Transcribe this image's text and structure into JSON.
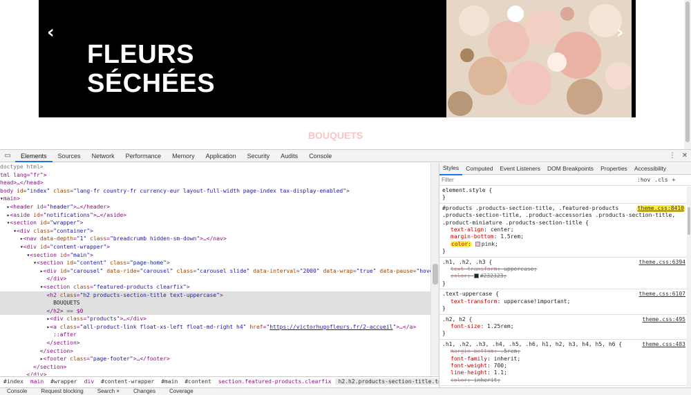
{
  "page": {
    "slide_line1": "FLEURS",
    "slide_line2": "SÉCHÉES",
    "arrow_left": "‹",
    "arrow_right": "›",
    "section_title": "BOUQUETS"
  },
  "devtools": {
    "tabs": [
      "Elements",
      "Sources",
      "Network",
      "Performance",
      "Memory",
      "Application",
      "Security",
      "Audits",
      "Console"
    ],
    "active_tab": "Elements",
    "dom": {
      "doctype": "doctype html>",
      "html_open": "tml lang=\"fr\">",
      "head": "head>…</head>",
      "body_id": "index",
      "body_class": "lang-fr country-fr currency-eur layout-full-width page-index tax-display-enabled",
      "main_tag": "main>",
      "header_id": "header",
      "aside_id": "notifications",
      "section_wrapper_id": "wrapper",
      "container_class": "container",
      "nav_depth": "1",
      "nav_class": "breadcrumb hidden-sm-down",
      "content_wrapper_id": "content-wrapper",
      "section_main_id": "main",
      "section_content_id": "content",
      "section_content_class": "page-home",
      "carousel_id": "carousel",
      "carousel_ride": "carousel",
      "carousel_class": "carousel slide",
      "carousel_interval": "2000",
      "carousel_wrap": "true",
      "carousel_pause": "hover",
      "featured_class": "featured-products clearfix",
      "h2_class": "h2 products-section-title text-uppercase",
      "h2_text": "BOUQUETS",
      "h2_close": "</h2> == $0",
      "products_class": "products",
      "a_class": "all-product-link float-xs-left float-md-right h4",
      "a_href": "https://victorhugofleurs.fr/2-accueil",
      "after": "::after",
      "footer_class": "page-footer"
    },
    "breadcrumb": [
      "#index",
      "main",
      "#wrapper",
      "div",
      "#content-wrapper",
      "#main",
      "#content",
      "section.featured-products.clearfix",
      "h2.h2.products-section-title.text-uppercase"
    ],
    "styles_tabs": [
      "Styles",
      "Computed",
      "Event Listeners",
      "DOM Breakpoints",
      "Properties",
      "Accessibility"
    ],
    "filter_placeholder": "Filter",
    "filter_hov": ":hov",
    "filter_cls": ".cls",
    "filter_plus": "+",
    "rules": {
      "element_style": "element.style {",
      "r1_selector": "#products .products-section-title, .featured-products\n.products-section-title, .product-accessories .products-section-title,\n.product-miniature .products-section-title {",
      "r1_source": "theme.css:8410",
      "r1_p1_name": "text-align",
      "r1_p1_val": "center;",
      "r1_p2_name": "margin-bottom",
      "r1_p2_val": "1.5rem;",
      "r1_p3_name": "color",
      "r1_p3_val": "pink;",
      "r2_selector": ".h1, .h2, .h3 {",
      "r2_source": "theme.css:6394",
      "r2_p1_name": "text-transform",
      "r2_p1_val": "uppercase;",
      "r2_p2_name": "color",
      "r2_p2_val": "#232323;",
      "r3_selector": ".text-uppercase {",
      "r3_source": "theme.css:6107",
      "r3_p1_name": "text-transform",
      "r3_p1_val": "uppercase!important;",
      "r4_selector": ".h2, h2 {",
      "r4_source": "theme.css:495",
      "r4_p1_name": "font-size",
      "r4_p1_val": "1.25rem;",
      "r5_selector": ".h1, .h2, .h3, .h4, .h5, .h6, h1, h2, h3, h4, h5, h6 {",
      "r5_source": "theme.css:483",
      "r5_p1_name": "margin-bottom",
      "r5_p1_val": ".5rem;",
      "r5_p2_name": "font-family",
      "r5_p2_val": "inherit;",
      "r5_p3_name": "font-weight",
      "r5_p3_val": "700;",
      "r5_p4_name": "line-height",
      "r5_p4_val": "1.1;",
      "r5_p5_name": "color",
      "r5_p5_val": "inherit;",
      "close_brace": "}"
    },
    "drawer_tabs": [
      "Console",
      "Request blocking",
      "Search ×",
      "Changes",
      "Coverage"
    ]
  },
  "colors": {
    "section_title": "#f8c4c8",
    "highlight": "#ffeb3b",
    "accent": "#1a73e8"
  }
}
